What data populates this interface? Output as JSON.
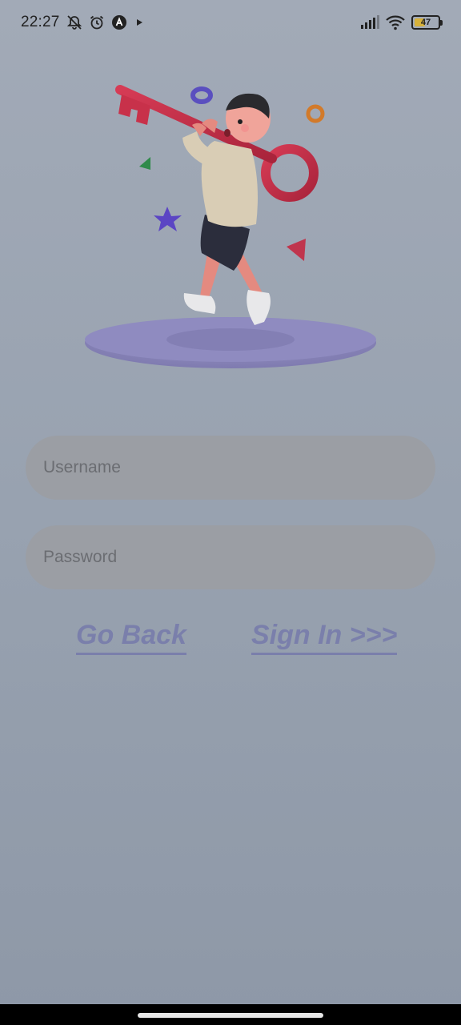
{
  "status_bar": {
    "time": "22:27",
    "battery_level": "47",
    "battery_fraction": 0.47,
    "icons_left": [
      "notifications-off-icon",
      "alarm-icon",
      "app-a-icon",
      "play-icon"
    ],
    "icons_right": [
      "signal-icon",
      "wifi-icon",
      "battery-icon"
    ]
  },
  "illustration": {
    "icon": "key-character-illustration",
    "colors": {
      "key": "#c8314a",
      "platform": "#8a86b8",
      "sweater": "#d9cdb5",
      "shorts": "#2b2d3c"
    }
  },
  "form": {
    "username_placeholder": "Username",
    "password_placeholder": "Password"
  },
  "actions": {
    "go_back_label": "Go Back",
    "sign_in_label": "Sign In >>>"
  },
  "colors": {
    "background": "#98a2b0",
    "field_background": "#9b9ea4",
    "link": "#7a7fab"
  }
}
